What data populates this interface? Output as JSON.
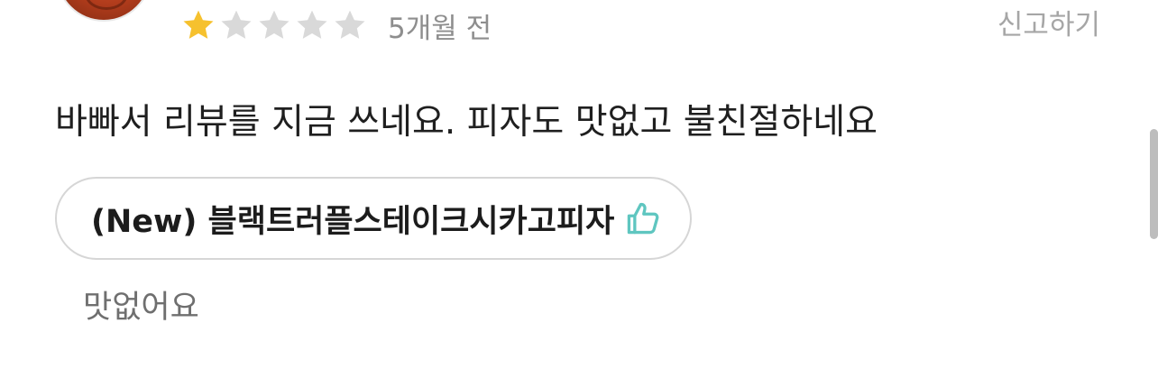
{
  "review": {
    "rating": 1,
    "max_rating": 5,
    "date": "5개월 전",
    "report_label": "신고하기",
    "text": "바빠서 리뷰를 지금 쓰네요. 피자도 맛없고 불친절하네요",
    "menu_item": {
      "name": "(New) 블랙트러플스테이크시카고피자",
      "icon": "thumbs-up-icon",
      "comment": "맛없어요"
    }
  },
  "colors": {
    "star_filled": "#F6C12E",
    "star_empty": "#D9D9D9",
    "thumb_icon": "#5FC6C0",
    "text_primary": "#1F1F1F",
    "text_secondary": "#8E8E8E"
  }
}
